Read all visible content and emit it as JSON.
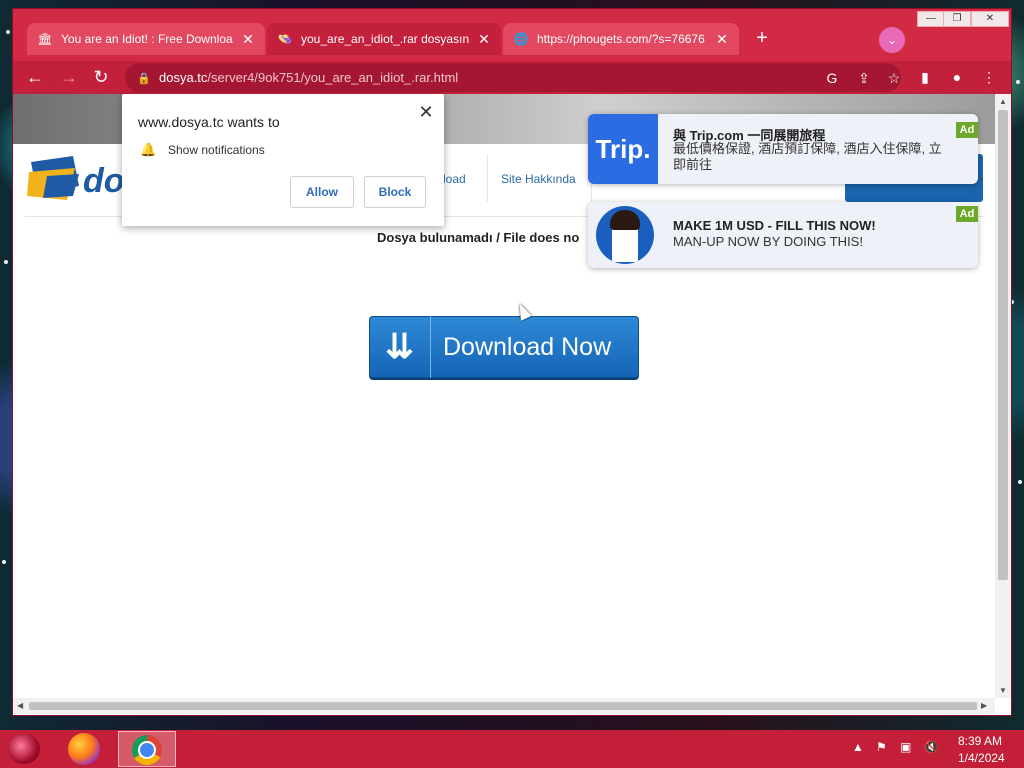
{
  "browser": {
    "tabs": [
      {
        "title": "You are an Idiot! : Free Download",
        "favicon": "bank-icon"
      },
      {
        "title": "you_are_an_idiot_.rar dosyasını indir",
        "favicon": "sombrero-icon"
      },
      {
        "title": "https://phougets.com/?s=76676",
        "favicon": "globe-icon"
      }
    ],
    "url_host": "dosya.tc",
    "url_path": "/server4/9ok751/you_are_an_idiot_.rar.html"
  },
  "site": {
    "logo_text": "dos",
    "nav": [
      "load",
      "Site Hakkında"
    ],
    "file_notice": "Dosya bulunamadı / File does no",
    "download_label": "Download Now"
  },
  "notification_prompt": {
    "title": "www.dosya.tc wants to",
    "permission": "Show notifications",
    "allow_label": "Allow",
    "block_label": "Block",
    "close_glyph": "✕"
  },
  "ads": [
    {
      "logo": "Trip.",
      "title": "與 Trip.com 一同展開旅程",
      "text": "最低價格保證, 酒店預訂保障, 酒店入住保障, 立即前往",
      "tag": "Ad"
    },
    {
      "title": "MAKE 1M USD - FILL THIS NOW!",
      "text": "MAN-UP NOW BY DOING THIS!",
      "tag": "Ad"
    }
  ],
  "taskbar": {
    "time": "8:39 AM",
    "date": "1/4/2024"
  },
  "colors": {
    "chrome_theme": "#d22a44",
    "toolbar": "#c3203b",
    "download_button": "#1d6fc4",
    "ad_tag": "#6ea82a"
  }
}
